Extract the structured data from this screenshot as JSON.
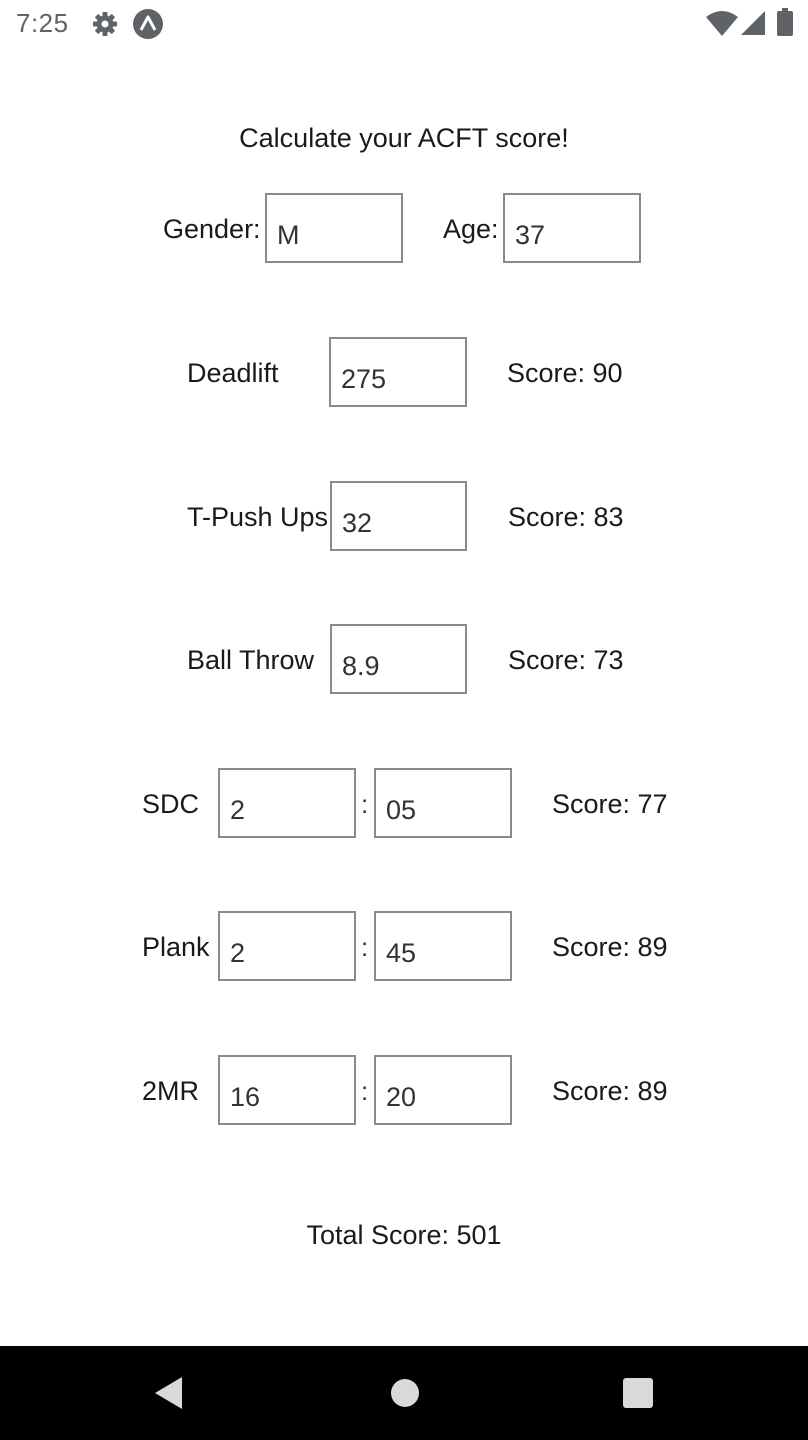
{
  "status_bar": {
    "time": "7:25",
    "left_icons": [
      "settings-gear-icon",
      "expo-app-icon"
    ],
    "right_icons": [
      "wifi-icon",
      "cellular-signal-icon",
      "battery-icon"
    ]
  },
  "header": {
    "title": "Calculate your ACFT score!"
  },
  "profile": {
    "gender_label": "Gender:",
    "gender_value": "M",
    "age_label": "Age:",
    "age_value": "37"
  },
  "events": {
    "deadlift": {
      "label": "Deadlift",
      "value": "275",
      "score": "Score: 90"
    },
    "pushups": {
      "label": "T-Push Ups",
      "value": "32",
      "score": "Score: 83"
    },
    "ball_throw": {
      "label": "Ball Throw",
      "value": "8.9",
      "score": "Score: 73"
    },
    "sdc": {
      "label": "SDC",
      "minutes": "2",
      "separator": ":",
      "seconds": "05",
      "score": "Score: 77"
    },
    "plank": {
      "label": "Plank",
      "minutes": "2",
      "separator": ":",
      "seconds": "45",
      "score": "Score: 89"
    },
    "two_mile_run": {
      "label": "2MR",
      "minutes": "16",
      "separator": ":",
      "seconds": "20",
      "score": "Score: 89"
    }
  },
  "total": {
    "text": "Total Score: 501"
  },
  "nav_bar": {
    "icons": [
      "back-icon",
      "home-icon",
      "recents-icon"
    ]
  },
  "colors": {
    "field_border": "#8a8a8a",
    "nav_background": "#000000",
    "status_text": "#5f6368"
  }
}
